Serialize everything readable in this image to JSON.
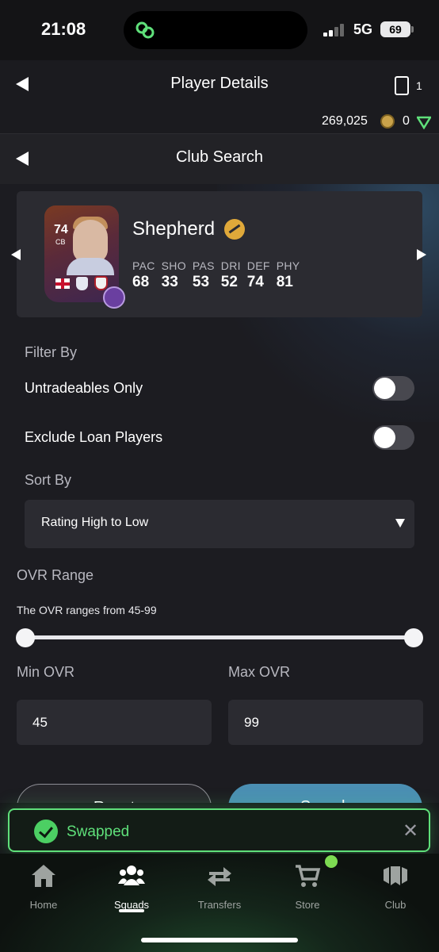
{
  "status_bar": {
    "time": "21:08",
    "network": "5G",
    "battery": "69"
  },
  "header": {
    "title": "Player Details",
    "token_count": "1",
    "coins": "269,025",
    "points": "0"
  },
  "subheader": {
    "title": "Club Search"
  },
  "player": {
    "name": "Shepherd",
    "card_rating": "74",
    "card_position": "CB",
    "stats": [
      {
        "label": "PAC",
        "value": "68"
      },
      {
        "label": "SHO",
        "value": "33"
      },
      {
        "label": "PAS",
        "value": "53"
      },
      {
        "label": "DRI",
        "value": "52"
      },
      {
        "label": "DEF",
        "value": "74"
      },
      {
        "label": "PHY",
        "value": "81"
      }
    ]
  },
  "filters": {
    "heading": "Filter By",
    "untradeables_label": "Untradeables Only",
    "untradeables_on": false,
    "exclude_loan_label": "Exclude Loan Players",
    "exclude_loan_on": false
  },
  "sort": {
    "heading": "Sort By",
    "selected": "Rating High to Low"
  },
  "ovr": {
    "heading": "OVR Range",
    "note": "The OVR ranges from 45-99",
    "min_label": "Min OVR",
    "max_label": "Max OVR",
    "min_value": "45",
    "max_value": "99",
    "slider_min": 45,
    "slider_max": 99
  },
  "actions": {
    "reset_label": "Reset",
    "search_label": "Search"
  },
  "toast": {
    "message": "Swapped"
  },
  "bottom_nav": [
    {
      "label": "Home",
      "icon": "home-icon"
    },
    {
      "label": "Squads",
      "icon": "squads-icon",
      "active": true
    },
    {
      "label": "Transfers",
      "icon": "transfers-icon"
    },
    {
      "label": "Store",
      "icon": "store-icon"
    },
    {
      "label": "Club",
      "icon": "club-icon"
    }
  ],
  "colors": {
    "accent_green": "#5fe07a",
    "search_blue": "#4b8fb3",
    "background": "#1c1c21"
  }
}
